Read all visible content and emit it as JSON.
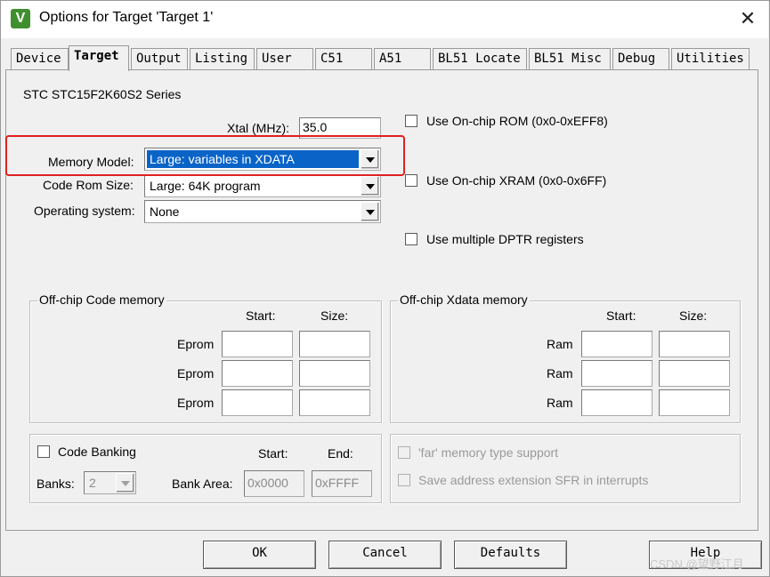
{
  "window": {
    "title": "Options for Target 'Target 1'",
    "app_icon": "keil-uvision-icon",
    "close_glyph": "✕"
  },
  "tabs": [
    "Device",
    "Target",
    "Output",
    "Listing",
    "User",
    "C51",
    "A51",
    "BL51 Locate",
    "BL51 Misc",
    "Debug",
    "Utilities"
  ],
  "active_tab": "Target",
  "device_series": "STC STC15F2K60S2 Series",
  "xtal": {
    "label": "Xtal (MHz):",
    "value": "35.0"
  },
  "memory_model": {
    "label": "Memory Model:",
    "value": "Large: variables in XDATA"
  },
  "code_rom_size": {
    "label": "Code Rom Size:",
    "value": "Large: 64K program"
  },
  "operating_system": {
    "label": "Operating system:",
    "value": "None"
  },
  "options": {
    "onchip_rom": "Use On-chip ROM (0x0-0xEFF8)",
    "onchip_xram": "Use On-chip XRAM (0x0-0x6FF)",
    "multiple_dptr": "Use multiple DPTR registers"
  },
  "code_memory": {
    "title": "Off-chip Code memory",
    "start_header": "Start:",
    "size_header": "Size:",
    "rows": [
      {
        "label": "Eprom",
        "start": "",
        "size": ""
      },
      {
        "label": "Eprom",
        "start": "",
        "size": ""
      },
      {
        "label": "Eprom",
        "start": "",
        "size": ""
      }
    ]
  },
  "xdata_memory": {
    "title": "Off-chip Xdata memory",
    "start_header": "Start:",
    "size_header": "Size:",
    "rows": [
      {
        "label": "Ram",
        "start": "",
        "size": ""
      },
      {
        "label": "Ram",
        "start": "",
        "size": ""
      },
      {
        "label": "Ram",
        "start": "",
        "size": ""
      }
    ]
  },
  "banking": {
    "checkbox_label": "Code Banking",
    "banks_label": "Banks:",
    "banks_value": "2",
    "bank_area_label": "Bank Area:",
    "start_header": "Start:",
    "end_header": "End:",
    "start_value": "0x0000",
    "end_value": "0xFFFF"
  },
  "misc": {
    "far_memory": "'far' memory type support",
    "save_sfr": "Save address extension SFR in interrupts"
  },
  "buttons": {
    "ok": "OK",
    "cancel": "Cancel",
    "defaults": "Defaults",
    "help": "Help"
  },
  "watermark": "CSDN @望野江月",
  "colors": {
    "highlight": "#e02020",
    "selection": "#0a64c8",
    "dialog_bg": "#f0f0f0"
  }
}
